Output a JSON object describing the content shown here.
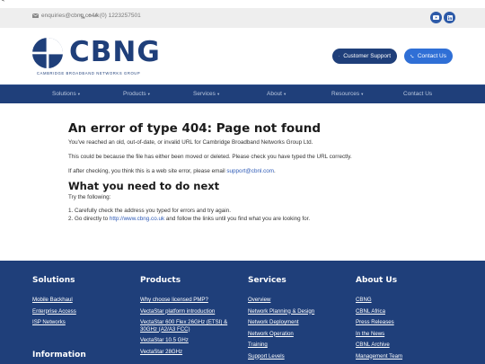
{
  "corner_mark": "<",
  "topbar": {
    "email": "enquiries@cbng.co.uk",
    "phone": "+44 (0) 1223257501",
    "email_icon": "envelope-icon",
    "phone_icon": "phone-icon",
    "social": [
      "youtube-icon",
      "linkedin-icon"
    ]
  },
  "header": {
    "logo_text": "CBNG",
    "tagline": "CAMBRIDGE BROADBAND NETWORKS GROUP",
    "support_label": "Customer Support",
    "contact_label": "Contact Us"
  },
  "nav": {
    "items": [
      {
        "label": "Solutions",
        "dropdown": true
      },
      {
        "label": "Products",
        "dropdown": true
      },
      {
        "label": "Services",
        "dropdown": true
      },
      {
        "label": "About",
        "dropdown": true
      },
      {
        "label": "Resources",
        "dropdown": true
      },
      {
        "label": "Contact Us",
        "dropdown": false
      }
    ],
    "caret": "▾"
  },
  "main": {
    "title": "An error of type 404: Page not found",
    "p1": "You've reached an old, out-of-date, or invalid URL for Cambridge Broadband Networks Group Ltd.",
    "p2": "This could be because the file has either been moved or deleted. Please check you have typed the URL correctly.",
    "p3_prefix": "If after checking, you think this is a web site error, please email ",
    "p3_link": "support@cbnl.com",
    "p3_suffix": ".",
    "h2": "What you need to do next",
    "try": "Try the following:",
    "step1": "1. Carefully check the address you typed for errors and try again.",
    "step2_prefix": "2. Go directly to ",
    "step2_link": "http://www.cbng.co.uk",
    "step2_suffix": " and follow the links until you find what you are looking for."
  },
  "footer": {
    "columns": [
      {
        "heading": "Solutions",
        "links": [
          "Mobile Backhaul",
          "Enterprise Access",
          "ISP Networks"
        ]
      },
      {
        "heading": "Products",
        "links": [
          "Why choose licensed PMP?",
          "VectaStar platform introduction",
          "VectaStar 600 Flex 26GHz (ETSI) & 30GHz (A2/A3 FCC)",
          "VectaStar 10.5 GHz",
          "VectaStar 28GHz"
        ]
      },
      {
        "heading": "Services",
        "links": [
          "Overview",
          "Network Planning & Design",
          "Network Deployment",
          "Network Operation",
          "Training",
          "Support Levels"
        ]
      },
      {
        "heading": "About Us",
        "links": [
          "CBNG",
          "CBNL Africa",
          "Press Releases",
          "In the News",
          "CBNL Archive",
          "Management Team"
        ]
      }
    ],
    "information_heading": "Information"
  },
  "colors": {
    "brand_navy": "#1f3f7a",
    "brand_blue": "#2f6fd6",
    "link_blue": "#2f5bb7",
    "topbar_bg": "#eeeeee"
  }
}
